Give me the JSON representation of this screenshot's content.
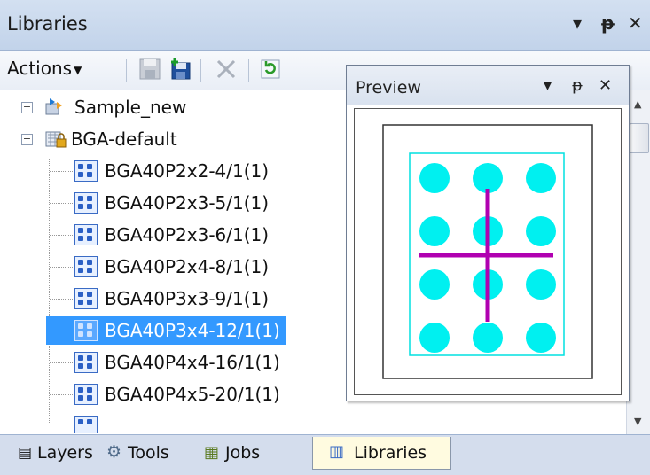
{
  "panel": {
    "title": "Libraries",
    "icons": [
      "dropdown-arrow-icon",
      "pin-icon",
      "close-icon"
    ]
  },
  "toolbar": {
    "actions_label": "Actions",
    "buttons": [
      "save-icon",
      "save-all-icon",
      "delete-icon",
      "refresh-icon"
    ]
  },
  "tree": {
    "roots": [
      {
        "label": "Sample_new",
        "expanded": false
      },
      {
        "label": "BGA-default",
        "expanded": true
      }
    ],
    "items": [
      {
        "label": "BGA40P2x2-4/1(1)"
      },
      {
        "label": "BGA40P2x3-5/1(1)"
      },
      {
        "label": "BGA40P2x3-6/1(1)"
      },
      {
        "label": "BGA40P2x4-8/1(1)"
      },
      {
        "label": "BGA40P3x3-9/1(1)"
      },
      {
        "label": "BGA40P3x4-12/1(1)",
        "selected": true
      },
      {
        "label": "BGA40P4x4-16/1(1)"
      },
      {
        "label": "BGA40P4x5-20/1(1)"
      }
    ]
  },
  "preview": {
    "title": "Preview",
    "pad_color": "#00f0f0",
    "cross_color": "#b000b0",
    "grid_cols": 3,
    "grid_rows": 4
  },
  "tabs": [
    {
      "label": "Layers"
    },
    {
      "label": "Tools"
    },
    {
      "label": "Jobs"
    },
    {
      "label": "Libraries",
      "active": true
    }
  ],
  "colors": {
    "selection": "#3399ff",
    "title_bg": "#c9d8ee"
  }
}
